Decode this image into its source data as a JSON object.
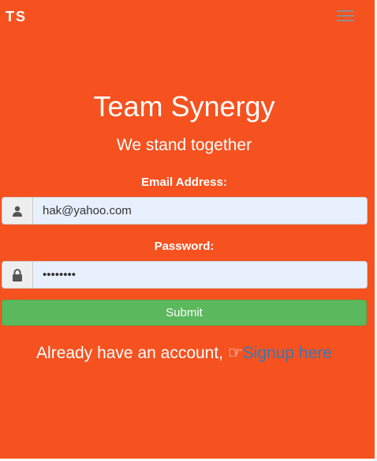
{
  "navbar": {
    "brand": "TS",
    "menu_icon": "hamburger-icon"
  },
  "hero": {
    "title": "Team Synergy",
    "subtitle": "We stand together"
  },
  "form": {
    "email_label": "Email Address:",
    "email_value": "hak@yahoo.com",
    "email_icon": "user-icon",
    "password_label": "Password:",
    "password_value": "password",
    "password_icon": "lock-icon",
    "submit_label": "Submit"
  },
  "footer": {
    "text": "Already have an account,",
    "link_icon": "hand-point-right-icon",
    "link": "Signup here"
  },
  "colors": {
    "background": "#f55220",
    "submit": "#5cb85c",
    "link": "#337ab7"
  }
}
